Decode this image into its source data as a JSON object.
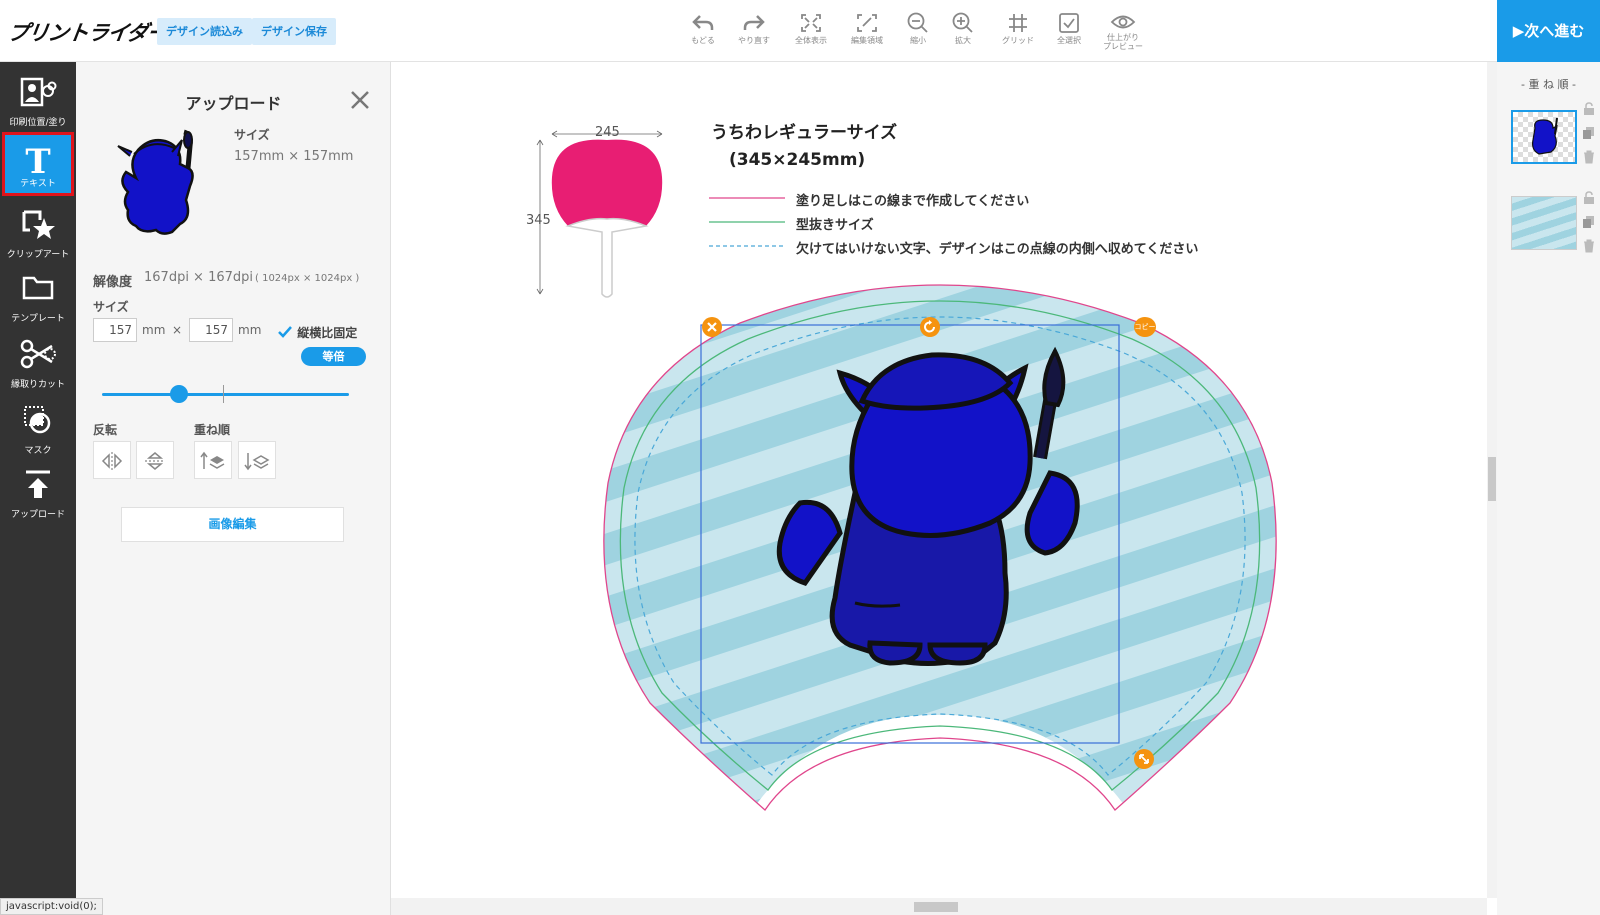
{
  "header": {
    "logo": "プリントライダー",
    "load_design": "デザイン読込み",
    "save_design": "デザイン保存",
    "tools": [
      {
        "label": "もどる",
        "icon": "undo-icon"
      },
      {
        "label": "やり直す",
        "icon": "redo-icon"
      },
      {
        "label": "全体表示",
        "icon": "fit-view-icon"
      },
      {
        "label": "編集領域",
        "icon": "edit-area-icon"
      },
      {
        "label": "縮小",
        "icon": "zoom-out-icon"
      },
      {
        "label": "拡大",
        "icon": "zoom-in-icon"
      },
      {
        "label": "グリッド",
        "icon": "grid-icon"
      },
      {
        "label": "全選択",
        "icon": "select-all-icon"
      },
      {
        "label": "仕上がり\nプレビュー",
        "icon": "preview-icon"
      }
    ],
    "next": "▶次へ進む"
  },
  "sidebar": {
    "items": [
      {
        "label": "印刷位置/塗り",
        "icon": "print-position-icon"
      },
      {
        "label": "テキスト",
        "icon": "text-icon",
        "active": true
      },
      {
        "label": "クリップアート",
        "icon": "clipart-icon"
      },
      {
        "label": "テンプレート",
        "icon": "template-folder-icon"
      },
      {
        "label": "縁取りカット",
        "icon": "scissors-icon"
      },
      {
        "label": "マスク",
        "icon": "mask-icon"
      },
      {
        "label": "アップロード",
        "icon": "upload-icon"
      }
    ]
  },
  "panel": {
    "title": "アップロード",
    "size_label": "サイズ",
    "size_value": "157mm × 157mm",
    "resolution_label": "解像度",
    "resolution_value": "167dpi × 167dpi",
    "resolution_px": "( 1024px × 1024px )",
    "size_input_label": "サイズ",
    "width": "157",
    "height": "157",
    "unit": "mm",
    "times": "×",
    "lock_ratio": "縦横比固定",
    "actual_size": "等倍",
    "scale_slider": 0.31,
    "flip_label": "反転",
    "order_label": "重ね順",
    "edit_image": "画像編集"
  },
  "canvas": {
    "guide_width": "245",
    "guide_height": "345",
    "title_line1": "うちわレギュラーサイズ",
    "title_line2": "(345×245mm)",
    "legend_bleed": "塗り足しはこの線まで作成してください",
    "legend_cut": "型抜きサイズ",
    "legend_safe": "欠けてはいけない文字、デザインはこの点線の内側へ収めてください",
    "copy_label": "コピー",
    "colors": {
      "bleed": "#e0468c",
      "cut": "#4cb87a",
      "safe": "#4aa8d8",
      "fan": "#e81e73",
      "character": "#1212c8",
      "selection": "#3a6fd8",
      "handle": "#f5930f"
    }
  },
  "layers": {
    "title": "- 重 ね 順 -"
  },
  "status": {
    "text": "javascript:void(0);"
  }
}
